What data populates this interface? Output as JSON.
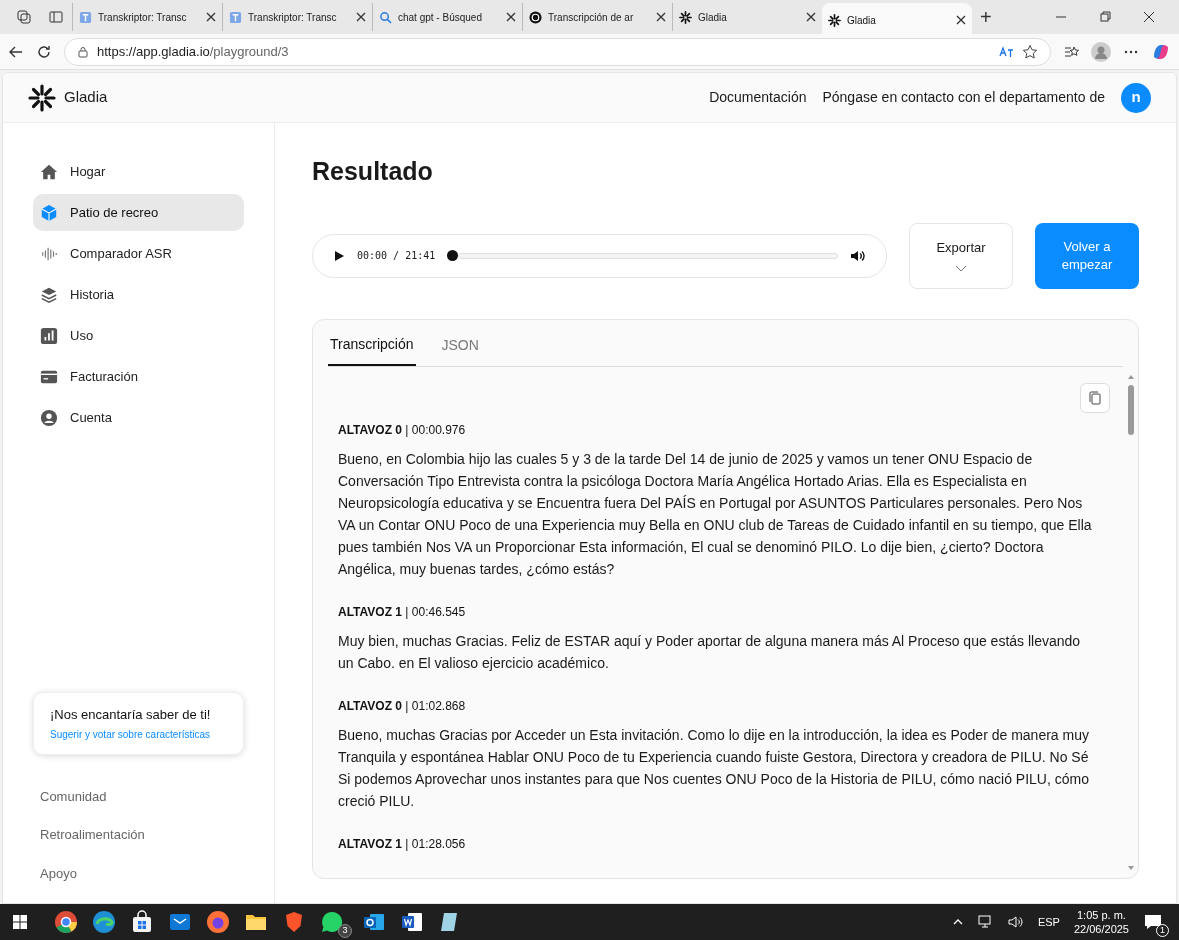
{
  "browser": {
    "tabs": [
      {
        "title": "Transkriptor: Transc",
        "selected": false
      },
      {
        "title": "Transkriptor: Transc",
        "selected": false
      },
      {
        "title": "chat gpt - Búsqued",
        "selected": false
      },
      {
        "title": "Transcripción de ar",
        "selected": false
      },
      {
        "title": "Gladia",
        "selected": false
      },
      {
        "title": "Gladia",
        "selected": true
      }
    ],
    "new_tab": "+",
    "address": {
      "host": "https://app.gladia.io",
      "path": "/playground/3"
    }
  },
  "header": {
    "brand": "Gladia",
    "links": [
      "Documentación",
      "Póngase en contacto con el departamento de"
    ],
    "avatar": "n"
  },
  "sidebar": {
    "items": [
      {
        "label": "Hogar",
        "selected": false
      },
      {
        "label": "Patio de recreo",
        "selected": true
      },
      {
        "label": "Comparador ASR",
        "selected": false
      },
      {
        "label": "Historia",
        "selected": false
      },
      {
        "label": "Uso",
        "selected": false
      },
      {
        "label": "Facturación",
        "selected": false
      },
      {
        "label": "Cuenta",
        "selected": false
      }
    ],
    "feedback_card": {
      "title": "¡Nos encantaría saber de ti!",
      "link": "Sugerir y votar sobre características"
    },
    "footer_links": [
      "Comunidad",
      "Retroalimentación",
      "Apoyo"
    ]
  },
  "main": {
    "title": "Resultado",
    "player": {
      "time": "00:00 / 21:41",
      "level": 0
    },
    "export_button": "Exportar",
    "restart_button": "Volver a empezar",
    "tabs": [
      {
        "label": "Transcripción",
        "selected": true
      },
      {
        "label": "JSON",
        "selected": false
      }
    ],
    "segments": [
      {
        "header": "**ALTAVOZ 0** | 00:00.976",
        "text": "Bueno, en Colombia hijo las cuales 5 y 3 de la tarde Del 14 de junio de 2025 y vamos un tener ONU Espacio de Conversación Tipo Entrevista contra la psicóloga Doctora María Angélica Hortado Arias. Ella es Especialista en Neuropsicología educativa y se Encuentra fuera Del PAÍS en Portugal por ASUNTOS Particulares personales. Pero Nos VA un Contar ONU Poco de una Experiencia muy Bella en ONU club de Tareas de Cuidado infantil en su tiempo, que Ella pues también Nos VA un Proporcionar Esta información, El cual se denominó PILO. Lo dije bien, ¿cierto? Doctora Angélica, muy buenas tardes, ¿cómo estás?"
      },
      {
        "header": "**ALTAVOZ 1** | 00:46.545",
        "text": "Muy bien, muchas Gracias. Feliz de ESTAR aquí y Poder aportar de alguna manera más Al Proceso que estás llevando un Cabo. en El valioso ejercicio académico."
      },
      {
        "header": "**ALTAVOZ 0** | 01:02.868",
        "text": "Bueno, muchas Gracias por Acceder un Esta invitación. Como lo dije en la introducción, la idea es Poder de manera muy Tranquila y espontánea Hablar ONU Poco de tu Experiencia cuando fuiste Gestora, Directora y creadora de PILU. No Sé Si podemos Aprovechar unos instantes para que Nos cuentes ONU Poco de la Historia de PILU, cómo nació PILU, cómo creció PILU."
      },
      {
        "header": "**ALTAVOZ 1** | 01:28.056"
      }
    ]
  },
  "taskbar": {
    "whatsapp_badge": "3",
    "language": "ESP",
    "time": "1:05 p. m.",
    "date": "22/06/2025",
    "notifications": "1"
  }
}
